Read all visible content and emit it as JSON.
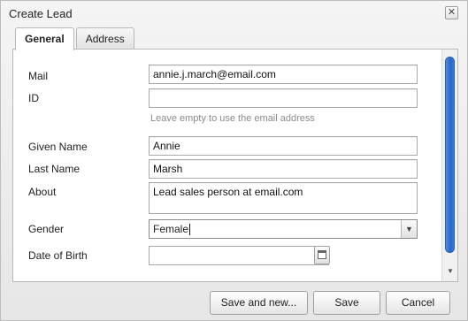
{
  "dialog": {
    "title": "Create Lead",
    "close_label": "✕"
  },
  "tabs": [
    {
      "label": "General",
      "active": true
    },
    {
      "label": "Address",
      "active": false
    }
  ],
  "form": {
    "mail": {
      "label": "Mail",
      "value": "annie.j.march@email.com"
    },
    "id": {
      "label": "ID",
      "value": "",
      "hint": "Leave empty to use the email address"
    },
    "given_name": {
      "label": "Given Name",
      "value": "Annie"
    },
    "last_name": {
      "label": "Last Name",
      "value": "Marsh"
    },
    "about": {
      "label": "About",
      "value": "Lead sales person at email.com"
    },
    "gender": {
      "label": "Gender",
      "value": "Female",
      "options": [
        "Female"
      ]
    },
    "date_of_birth": {
      "label": "Date of Birth",
      "value": ""
    }
  },
  "buttons": {
    "save_and_new": "Save and new...",
    "save": "Save",
    "cancel": "Cancel"
  },
  "icons": {
    "close": "close-icon",
    "dropdown": "chevron-down-icon",
    "calendar": "calendar-icon",
    "scroll_down": "arrow-down-icon"
  },
  "colors": {
    "scroll_thumb": "#2766c9"
  }
}
